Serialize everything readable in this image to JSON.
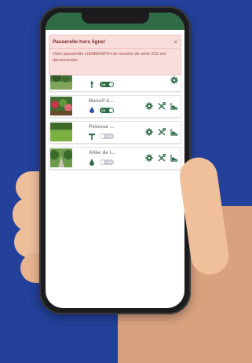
{
  "alert": {
    "title": "Passerelle hors ligne!",
    "close": "×",
    "message": "Votre passerelle LIEABEARTH de numéro de série X22 est déconnectée."
  },
  "zones": [
    {
      "name": "",
      "toggle": "ON",
      "toggle_state": "on",
      "icon": "sprinkler-icon"
    },
    {
      "name": "Massif d...",
      "toggle": "ON",
      "toggle_state": "on",
      "icon": "drop-icon"
    },
    {
      "name": "Pelouse ...",
      "toggle": "OFF",
      "toggle_state": "off",
      "icon": "sprinkler-icon"
    },
    {
      "name": "Allée de l...",
      "toggle": "OFF",
      "toggle_state": "off",
      "icon": "drip-icon"
    }
  ],
  "colors": {
    "accent": "#2f6b45",
    "background": "#23409a",
    "alert": "#f9dcdc"
  }
}
